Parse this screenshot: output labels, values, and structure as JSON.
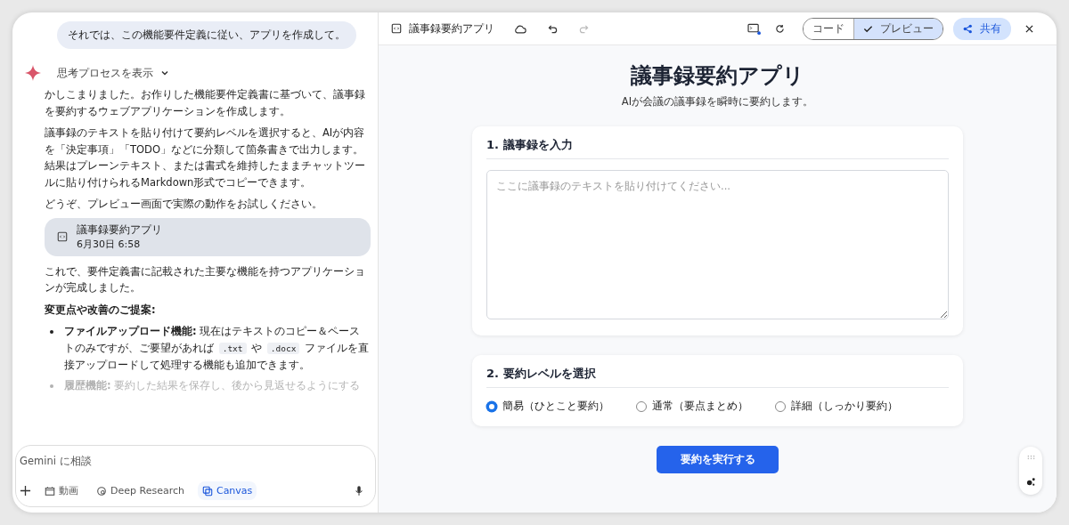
{
  "chat": {
    "user_message": "それでは、この機能要件定義に従い、アプリを作成して。",
    "thinking_toggle": "思考プロセスを表示",
    "paragraphs": [
      "かしこまりました。お作りした機能要件定義書に基づいて、議事録を要約するウェブアプリケーションを作成します。",
      "議事録のテキストを貼り付けて要約レベルを選択すると、AIが内容を「決定事項」「TODO」などに分類して箇条書きで出力します。結果はプレーンテキスト、または書式を維持したままチャットツールに貼り付けられるMarkdown形式でコピーできます。",
      "どうぞ、プレビュー画面で実際の動作をお試しください。"
    ],
    "artifact": {
      "title": "議事録要約アプリ",
      "date": "6月30日 6:58"
    },
    "after_paragraph": "これで、要件定義書に記載された主要な機能を持つアプリケーションが完成しました。",
    "suggestions_heading": "変更点や改善のご提案:",
    "suggestions": [
      {
        "title": "ファイルアップロード機能:",
        "faded": false,
        "segments": [
          {
            "kind": "text",
            "text": " 現在はテキストのコピー＆ペーストのみですが、ご要望があれば "
          },
          {
            "kind": "code",
            "text": ".txt"
          },
          {
            "kind": "text",
            "text": " や "
          },
          {
            "kind": "code",
            "text": ".docx"
          },
          {
            "kind": "text",
            "text": " ファイルを直接アップロードして処理する機能も追加できます。"
          }
        ]
      },
      {
        "title": "履歴機能:",
        "faded": true,
        "segments": [
          {
            "kind": "text",
            "text": " 要約した結果を保存し、後から見返せるようにする"
          }
        ]
      }
    ],
    "input": {
      "placeholder": "Gemini に相談"
    },
    "tools": [
      {
        "kind": "video",
        "label": "動画",
        "selected": false
      },
      {
        "kind": "research",
        "label": "Deep Research",
        "selected": false
      },
      {
        "kind": "canvas",
        "label": "Canvas",
        "selected": true
      }
    ]
  },
  "canvas": {
    "toolbar": {
      "title": "議事録要約アプリ",
      "view_toggle": [
        {
          "label": "コード",
          "selected": false
        },
        {
          "label": "プレビュー",
          "selected": true
        }
      ],
      "share": "共有"
    },
    "app": {
      "title": "議事録要約アプリ",
      "subtitle": "AIが会議の議事録を瞬時に要約します。",
      "input_section": {
        "heading": "1. 議事録を入力",
        "placeholder": "ここに議事録のテキストを貼り付けてください..."
      },
      "level_section": {
        "heading": "2. 要約レベルを選択",
        "options": [
          {
            "label": "簡易（ひとこと要約）",
            "selected": true
          },
          {
            "label": "通常（要点まとめ）",
            "selected": false
          },
          {
            "label": "詳細（しっかり要約）",
            "selected": false
          }
        ]
      },
      "run_button": "要約を実行する"
    }
  }
}
